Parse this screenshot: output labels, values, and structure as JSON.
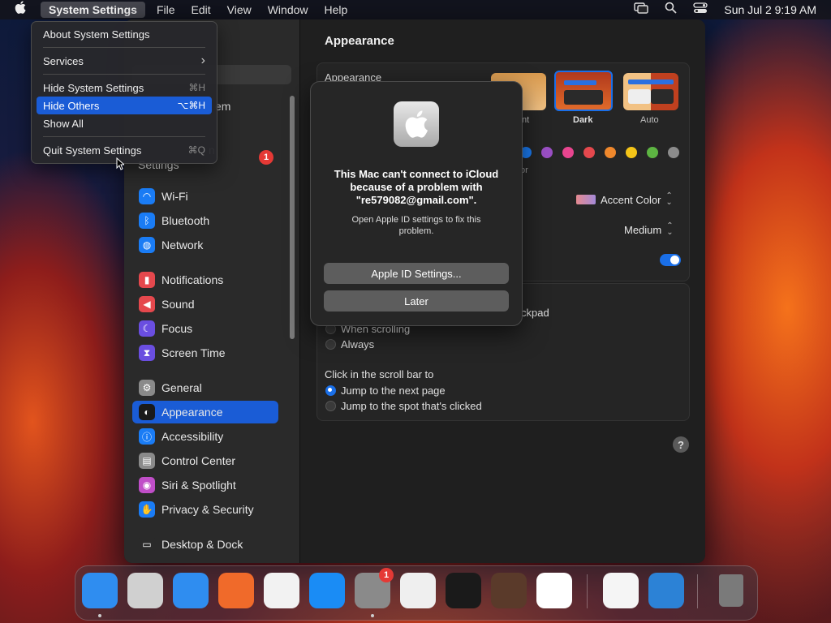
{
  "menubar": {
    "app_name": "System Settings",
    "items": [
      "File",
      "Edit",
      "View",
      "Window",
      "Help"
    ],
    "datetime": "Sun Jul 2  9:19 AM",
    "icons": [
      "apple-icon",
      "screen-mirroring-icon",
      "search-icon",
      "control-center-icon"
    ]
  },
  "app_menu": {
    "about": "About System Settings",
    "services": "Services",
    "services_arrow": "›",
    "hide": "Hide System Settings",
    "hide_shortcut": "⌘H",
    "hide_others": "Hide Others",
    "hide_others_shortcut": "⌥⌘H",
    "show_all": "Show All",
    "quit": "Quit System Settings",
    "quit_shortcut": "⌘Q"
  },
  "sidebar": {
    "partial_account_1": "em",
    "partial_account_2": "n",
    "partial_account_3": "Settings",
    "badge": "1",
    "items": [
      {
        "label": "Wi-Fi",
        "color": "#1a7cf5",
        "glyph": "◠"
      },
      {
        "label": "Bluetooth",
        "color": "#1a7cf5",
        "glyph": "ᛒ"
      },
      {
        "label": "Network",
        "color": "#1a7cf5",
        "glyph": "◍"
      },
      {
        "label": "Notifications",
        "color": "#e5484d",
        "glyph": "▮"
      },
      {
        "label": "Sound",
        "color": "#e5484d",
        "glyph": "◀"
      },
      {
        "label": "Focus",
        "color": "#6a4ee0",
        "glyph": "☾"
      },
      {
        "label": "Screen Time",
        "color": "#6a4ee0",
        "glyph": "⧗"
      },
      {
        "label": "General",
        "color": "#8a8a8a",
        "glyph": "⚙"
      },
      {
        "label": "Appearance",
        "color": "#1a1a1a",
        "glyph": "◐"
      },
      {
        "label": "Accessibility",
        "color": "#1a7cf5",
        "glyph": "ⓘ"
      },
      {
        "label": "Control Center",
        "color": "#8a8a8a",
        "glyph": "▤"
      },
      {
        "label": "Siri & Spotlight",
        "color": "#c04ec8",
        "glyph": "◉"
      },
      {
        "label": "Privacy & Security",
        "color": "#1a7cf5",
        "glyph": "✋"
      },
      {
        "label": "Desktop & Dock",
        "color": "#2a2a2a",
        "glyph": "▭"
      }
    ]
  },
  "main": {
    "title": "Appearance",
    "appearance_label": "Appearance",
    "theme_light_partial": "nt",
    "theme_dark": "Dark",
    "theme_auto": "Auto",
    "accent_partial": "or",
    "accent_colors": [
      "#1a7cf5",
      "#9a4fc4",
      "#e8458f",
      "#e5484d",
      "#f0882c",
      "#f5c518",
      "#5db542",
      "#8c8c8c"
    ],
    "highlight_value": "Accent Color",
    "sidebar_icon_size": "Medium",
    "scroll_partial": "ckpad",
    "when_scrolling": "When scrolling",
    "always": "Always",
    "click_scroll_label": "Click in the scroll bar to",
    "jump_next": "Jump to the next page",
    "jump_spot": "Jump to the spot that's clicked",
    "help": "?"
  },
  "alert": {
    "title": "This Mac can't connect to iCloud because of a problem with \"re579082@gmail.com\".",
    "message": "Open Apple ID settings to fix this problem.",
    "primary": "Apple ID Settings...",
    "secondary": "Later"
  },
  "dock": {
    "apps": [
      {
        "name": "finder-icon",
        "color": "#2f8df0"
      },
      {
        "name": "launchpad-icon",
        "color": "#d0d0d0"
      },
      {
        "name": "safari-icon",
        "color": "#2f8df0"
      },
      {
        "name": "firefox-icon",
        "color": "#f06a2a"
      },
      {
        "name": "chrome-icon",
        "color": "#f2f2f2"
      },
      {
        "name": "app-store-icon",
        "color": "#1a8cf5"
      },
      {
        "name": "system-settings-icon",
        "color": "#8a8a8a"
      },
      {
        "name": "textedit-icon",
        "color": "#efefef"
      },
      {
        "name": "terminal-icon",
        "color": "#1a1a1a"
      },
      {
        "name": "garageband-icon",
        "color": "#5a3a2a"
      },
      {
        "name": "vscode-icon",
        "color": "#ffffff"
      },
      {
        "name": "visual-studio-icon",
        "color": "#f5f5f5"
      },
      {
        "name": "weather-icon",
        "color": "#2c82d6"
      },
      {
        "name": "trash-icon",
        "color": "#6d6d6d"
      }
    ],
    "settings_badge": "1"
  }
}
